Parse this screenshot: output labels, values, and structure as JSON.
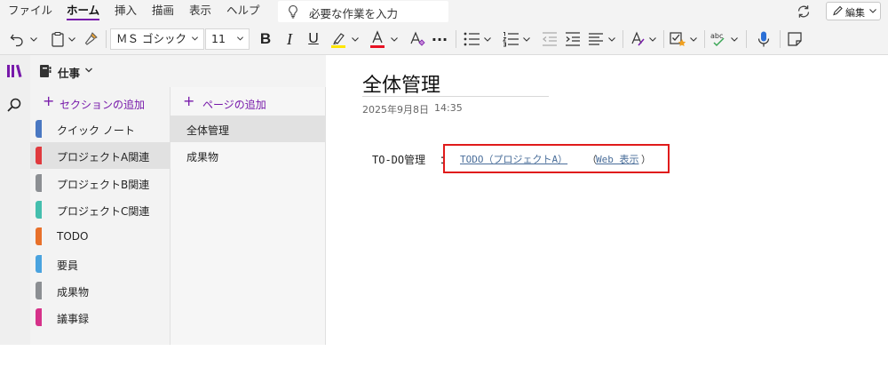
{
  "menu": {
    "tabs": [
      "ファイル",
      "ホーム",
      "挿入",
      "描画",
      "表示",
      "ヘルプ"
    ],
    "search_placeholder": "必要な作業を入力",
    "edit_label": "編集"
  },
  "ribbon": {
    "font_name": "ＭＳ ゴシック",
    "font_size": "11",
    "bold": "B",
    "italic": "I",
    "underline": "U",
    "more": "···",
    "highlight_color": "#ffe600",
    "font_color": "#e81123"
  },
  "notebook": {
    "name": "仕事",
    "add_section": "セクションの追加",
    "add_page": "ページの追加",
    "sections": [
      {
        "name": "クイック ノート",
        "color": "#4a78c2"
      },
      {
        "name": "プロジェクトA関連",
        "color": "#e03a3e"
      },
      {
        "name": "プロジェクトB関連",
        "color": "#8c8f93"
      },
      {
        "name": "プロジェクトC関連",
        "color": "#45bfae"
      },
      {
        "name": "TODO",
        "color": "#e8712b"
      },
      {
        "name": "要員",
        "color": "#4aa3df"
      },
      {
        "name": "成果物",
        "color": "#8c8f93"
      },
      {
        "name": "議事録",
        "color": "#d6328a"
      }
    ],
    "selected_section": "プロジェクトA関連",
    "pages": [
      "全体管理",
      "成果物"
    ],
    "selected_page": "全体管理"
  },
  "page": {
    "title": "全体管理",
    "date": "2025年9月8日",
    "time": "14:35",
    "todo_label": "TO-DO管理",
    "colon": "：",
    "link_text": "TODO（プロジェクトA）",
    "web_open": "（",
    "web_link": "Web 表示",
    "web_close": "）"
  },
  "accent_color": "#7719aa",
  "highlight_box_color": "#e01b1b"
}
